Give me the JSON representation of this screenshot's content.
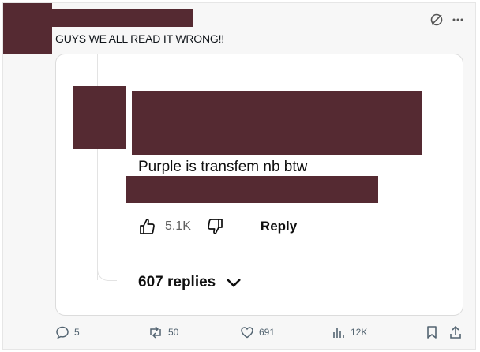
{
  "post": {
    "text": "GUYS WE ALL READ IT WRONG!!"
  },
  "comment": {
    "text": "Purple is transfem nb btw",
    "like_count": "5.1K",
    "reply_label": "Reply",
    "replies_label": "607 replies"
  },
  "stats": {
    "replies": "5",
    "reposts": "50",
    "likes": "691",
    "views": "12K"
  },
  "colors": {
    "redaction": "#552a32",
    "muted": "#536471"
  },
  "icons": [
    "grok-icon",
    "more-icon",
    "thumbs-up-icon",
    "thumbs-down-icon",
    "chevron-down-icon",
    "reply-icon",
    "repost-icon",
    "like-icon",
    "views-icon",
    "bookmark-icon",
    "share-icon"
  ]
}
